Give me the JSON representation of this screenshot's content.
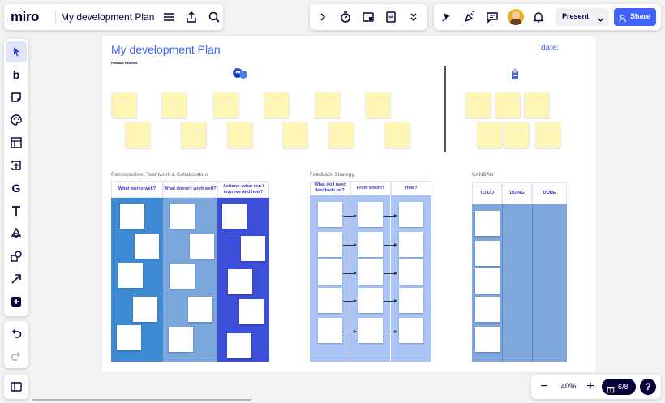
{
  "app": {
    "logo": "miro",
    "board_title": "My development Plan"
  },
  "topbar": {
    "present_label": "Present",
    "share_label": "Share"
  },
  "zoom": {
    "level": "40%",
    "minus": "−",
    "plus": "+"
  },
  "pages": {
    "counter": "6/8"
  },
  "help": {
    "label": "?"
  },
  "board": {
    "title": "My development Plan",
    "date_label": "date:",
    "feedback_received_label": "Feedback Received",
    "retro": {
      "title": "Retrospective: Teamwork & Collaboration",
      "columns": [
        "What works well?",
        "What doesn't work well?",
        "Actions: what can I improve and how?"
      ]
    },
    "strategy": {
      "title": "Feedback Strategy",
      "columns": [
        "What do I need feedback on?",
        "From whom?",
        "How?"
      ]
    },
    "kanban": {
      "title": "KANBAN",
      "columns": [
        "TO DO",
        "DOING",
        "DONE"
      ]
    }
  },
  "colors": {
    "accent": "#4262ff",
    "sticky_yellow": "#fff6b6",
    "retro_col1": "#3e8bd4",
    "retro_col2": "#7aa6dc",
    "retro_col3": "#3b4fd8",
    "strategy_bg": "#a9c4f5",
    "kanban_bg": "#7fa7dc"
  }
}
